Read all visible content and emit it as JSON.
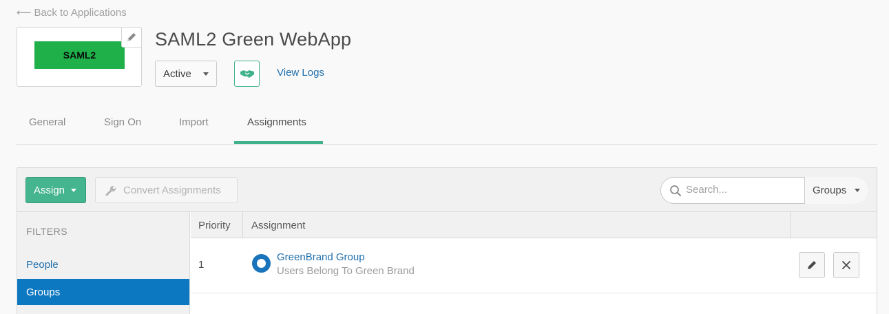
{
  "header": {
    "back_link": "Back to Applications",
    "app_title": "SAML2 Green WebApp",
    "logo_text": "SAML2",
    "status_value": "Active",
    "view_logs": "View Logs"
  },
  "tabs": [
    {
      "label": "General",
      "active": false
    },
    {
      "label": "Sign On",
      "active": false
    },
    {
      "label": "Import",
      "active": false
    },
    {
      "label": "Assignments",
      "active": true
    }
  ],
  "toolbar": {
    "assign_label": "Assign",
    "convert_label": "Convert Assignments",
    "search_placeholder": "Search...",
    "scope_value": "Groups"
  },
  "filters": {
    "title": "FILTERS",
    "items": [
      {
        "label": "People",
        "selected": false
      },
      {
        "label": "Groups",
        "selected": true
      }
    ]
  },
  "table": {
    "columns": [
      "Priority",
      "Assignment",
      ""
    ],
    "rows": [
      {
        "priority": "1",
        "name": "GreenBrand Group",
        "description": "Users Belong To Green Brand"
      }
    ]
  },
  "colors": {
    "accent_green": "#45b590",
    "logo_green": "#1fb04a",
    "link_blue": "#1f6fad",
    "selected_blue": "#0d78c2"
  },
  "icons": [
    "pencil-icon",
    "chevron-down-icon",
    "handshake-icon",
    "wrench-icon",
    "search-icon",
    "group-icon",
    "edit-icon",
    "close-icon",
    "left-arrow-icon"
  ]
}
